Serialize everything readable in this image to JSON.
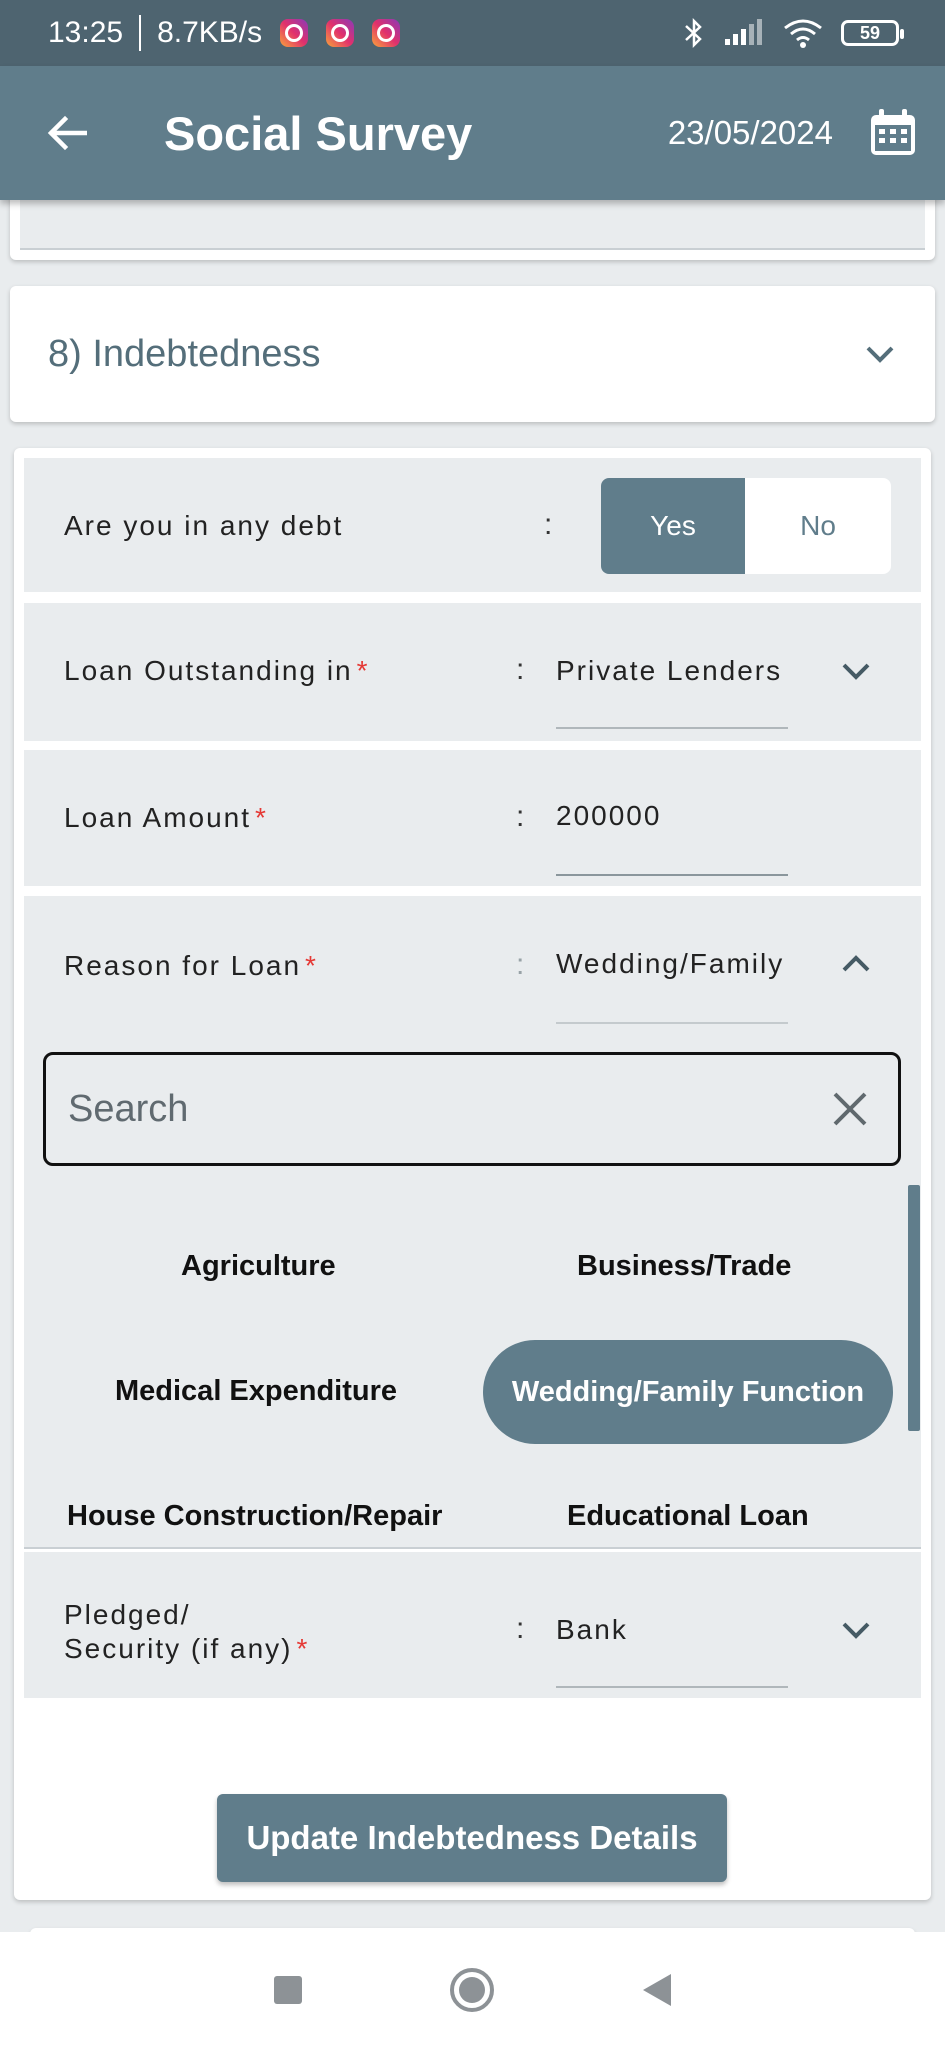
{
  "status_bar": {
    "time": "13:25",
    "speed": "8.7KB/s",
    "battery": "59"
  },
  "app_bar": {
    "title": "Social Survey",
    "date": "23/05/2024"
  },
  "section": {
    "title": "8) Indebtedness"
  },
  "debt_row": {
    "label": "Are you in any debt",
    "colon": ":",
    "yes": "Yes",
    "no": "No",
    "selected": "Yes"
  },
  "loan_outstanding": {
    "label": "Loan Outstanding in",
    "required": "*",
    "colon": ":",
    "value": "Private Lenders"
  },
  "loan_amount": {
    "label": "Loan Amount",
    "required": "*",
    "colon": ":",
    "value": "200000"
  },
  "reason_for_loan": {
    "label": "Reason for Loan",
    "required": "*",
    "colon": ":",
    "value": "Wedding/Family Function",
    "search_placeholder": "Search",
    "options": [
      "Agriculture",
      "Business/Trade",
      "Medical Expenditure",
      "Wedding/Family Function",
      "House Construction/Repair",
      "Educational Loan"
    ],
    "selected_option": "Wedding/Family Function"
  },
  "pledged": {
    "label_line1": "Pledged/",
    "label_line2": "Security (if any)",
    "required": "*",
    "colon": ":",
    "value": "Bank"
  },
  "update_button": "Update Indebtedness Details",
  "colors": {
    "primary": "#607d8b",
    "status_bar": "#4e6470",
    "background": "#e9ecee",
    "required": "#e53935"
  }
}
